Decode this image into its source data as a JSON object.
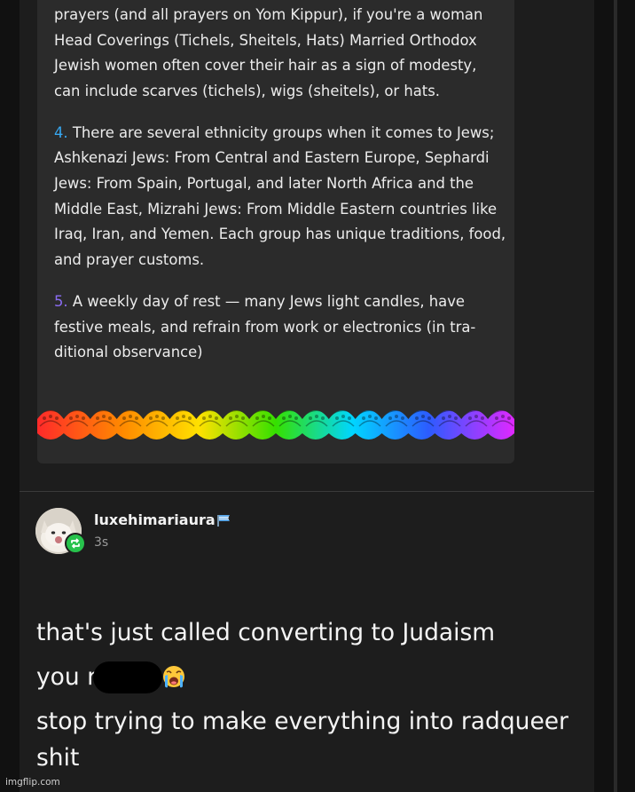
{
  "card": {
    "para_prayer": "prayers (and all prayers on Yom Kippur), if you're a woman Head Coverings (Tichels, Sheitels, Hats) Married Orthodox Jewish women often cover their hair as a sign of modesty, can include scarves (tichels), wigs (sheitels), or hats.",
    "item4_number": "4.",
    "item4_text": "There are several ethnicity groups when it comes to Jews; Ashkenazi Jews: From Central and Eastern Europe, Sephardi Jews: From Spain, Portugal, and later North Africa and the Middle East, Mizrahi Jews: From Middle Eastern countries like Iraq, Iran, and Yemen. Each group has unique traditions, food, and prayer customs.",
    "item5_number": "5.",
    "item5_text": "A weekly day of rest —  many Jews light candles, have festive meals, and refrain from work or electronics (in tra-ditional observance)",
    "number4_color": "#37a7f0",
    "number5_color": "#8a6cf2"
  },
  "post": {
    "username": "luxehimariaura",
    "timestamp": "3s",
    "user_badge_icon": "flag-badge-icon",
    "reblog_icon": "reblog-icon",
    "reply_line1": "that's just called converting to Judaism",
    "reply_line2_start": "you r",
    "reply_emoji_icon": "loudly-crying-face-icon",
    "reply_line3": "stop trying to make everything into radqueer shit"
  },
  "watermark": "imgflip.com"
}
